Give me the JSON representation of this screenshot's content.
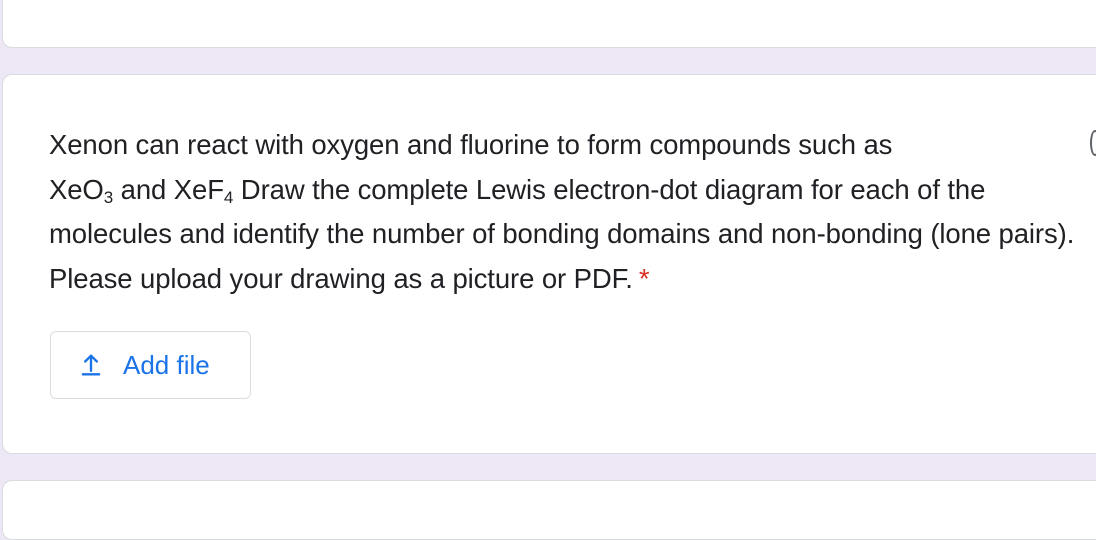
{
  "question": {
    "line1": "Xenon can react with oxygen and fluorine to form compounds such as",
    "formula1_base": "XeO",
    "formula1_sub": "3",
    "conjunction": " and ",
    "formula2_base": "XeF",
    "formula2_sub": "4",
    "rest": " Draw the complete Lewis electron-dot diagram for each of the molecules and identify the number of bonding domains and non-bonding (lone pairs). Please upload your drawing as a picture or PDF.",
    "required_mark": "*"
  },
  "upload": {
    "icon": "upload-icon",
    "label": "Add file"
  },
  "colors": {
    "page_background": "#ede7f6",
    "card_background": "#ffffff",
    "accent": "#1a73e8",
    "required": "#d93025",
    "text": "#202124"
  }
}
